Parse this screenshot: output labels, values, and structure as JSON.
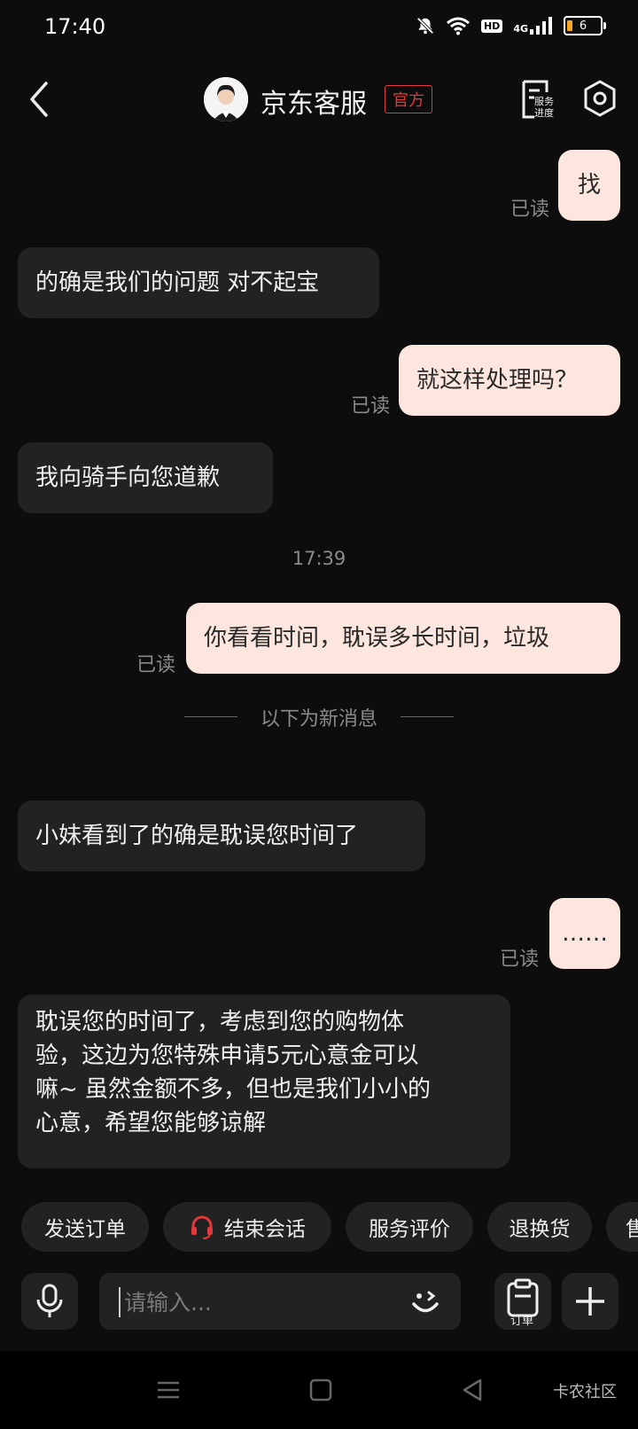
{
  "status_bar": {
    "time": "17:40",
    "hd": "HD",
    "network": "4G",
    "battery": "6"
  },
  "header": {
    "title": "京东客服",
    "badge": "官方",
    "service_progress_label_1": "服务",
    "service_progress_label_2": "进度"
  },
  "messages": [
    {
      "side": "out",
      "text": "找",
      "read": "已读"
    },
    {
      "side": "in",
      "text": "的确是我们的问题 对不起宝"
    },
    {
      "side": "out",
      "text": "就这样处理吗？",
      "read": "已读"
    },
    {
      "side": "in",
      "text": "我向骑手向您道歉"
    },
    {
      "side": "out",
      "text": "你看看时间，耽误多长时间，垃圾",
      "read": "已读"
    },
    {
      "side": "in",
      "text": "小妹看到了的确是耽误您时间了"
    },
    {
      "side": "out",
      "text": "……",
      "read": "已读"
    },
    {
      "side": "in",
      "lines": [
        "耽误您的时间了，考虑到您的购物体",
        "验，这边为您特殊申请5元心意金可以",
        "嘛~ 虽然金额不多，但也是我们小小的",
        "心意，希望您能够谅解"
      ]
    }
  ],
  "time_separator": "17:39",
  "new_messages_divider": "以下为新消息",
  "quick_actions": [
    "发送订单",
    "结束会话",
    "服务评价",
    "退换货",
    "售"
  ],
  "input": {
    "placeholder": "请输入..."
  },
  "order_label": "订单",
  "watermark": "卡农社区",
  "colors": {
    "bubble_out": "#fce6dd",
    "bubble_in": "#222222",
    "accent_red": "#e23a3a",
    "background": "#0d0d0d"
  }
}
